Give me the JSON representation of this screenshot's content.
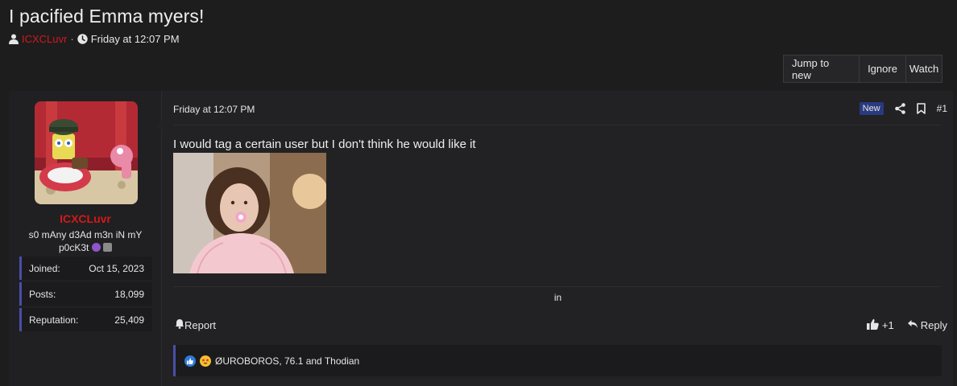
{
  "thread": {
    "title": "I pacified Emma myers!",
    "author": "ICXCLuvr",
    "separator": "·",
    "date": "Friday at 12:07 PM"
  },
  "thread_buttons": {
    "jump": "Jump to new",
    "ignore": "Ignore",
    "watch": "Watch"
  },
  "user": {
    "name": "ICXCLuvr",
    "title": "s0 mAny d3Ad m3n iN mY p0cK3t",
    "stats": {
      "joined_label": "Joined:",
      "joined_value": "Oct 15, 2023",
      "posts_label": "Posts:",
      "posts_value": "18,099",
      "rep_label": "Reputation:",
      "rep_value": "25,409"
    }
  },
  "post": {
    "date": "Friday at 12:07 PM",
    "new_badge": "New",
    "number": "#1",
    "body": "I would tag a certain user but I don't think he would like it",
    "signature": "in",
    "report_label": "Report",
    "like_count": "+1",
    "reply_label": "Reply",
    "reactions_text": "ØUROBOROS, 76.1 and Thodian"
  },
  "colors": {
    "background": "#1d1d1e",
    "post_background": "#222224",
    "username": "#d31919",
    "accent_border": "#4a4ea8",
    "new_badge": "#2a3a80"
  },
  "icons": {
    "user": "user-icon",
    "clock": "clock-icon",
    "share": "share-icon",
    "bookmark": "bookmark-icon",
    "bell": "bell-icon",
    "thumbs_up": "thumbs-up-icon",
    "reply": "reply-icon",
    "like_reaction": "like-reaction-icon",
    "love_reaction": "star-eyes-reaction-icon"
  }
}
